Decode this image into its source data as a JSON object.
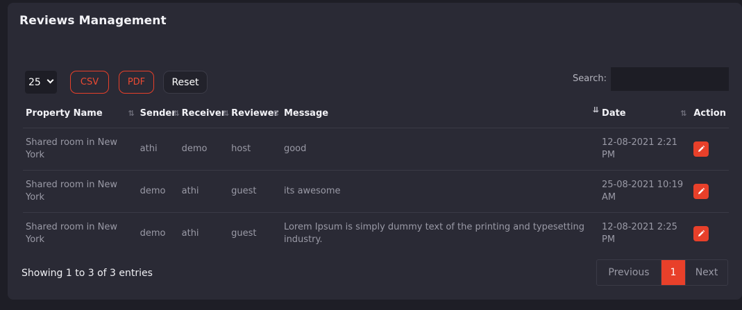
{
  "page": {
    "title": "Reviews Management"
  },
  "toolbar": {
    "page_length": "25",
    "csv_label": "CSV",
    "pdf_label": "PDF",
    "reset_label": "Reset",
    "search_label": "Search:",
    "search_value": ""
  },
  "table": {
    "headers": [
      "Property Name",
      "Sender",
      "Receiver",
      "Reviewer",
      "Message",
      "Date",
      "Action"
    ],
    "rows": [
      {
        "property": "Shared room in New York",
        "sender": "athi",
        "receiver": "demo",
        "reviewer": "host",
        "message": "good",
        "date": "12-08-2021 2:21 PM"
      },
      {
        "property": "Shared room in New York",
        "sender": "demo",
        "receiver": "athi",
        "reviewer": "guest",
        "message": "its awesome",
        "date": "25-08-2021 10:19 AM"
      },
      {
        "property": "Shared room in New York",
        "sender": "demo",
        "receiver": "athi",
        "reviewer": "guest",
        "message": "Lorem Ipsum is simply dummy text of the printing and typesetting industry.",
        "date": "12-08-2021 2:25 PM"
      }
    ]
  },
  "footer": {
    "info": "Showing 1 to 3 of 3 entries",
    "prev_label": "Previous",
    "page_1": "1",
    "next_label": "Next"
  },
  "icons": {
    "edit": "pencil-icon",
    "sort": "sort-arrows-icon",
    "dropdown": "chevron-down-icon"
  },
  "colors": {
    "accent": "#e8402a",
    "card": "#2a2a35",
    "background": "#1e1e26"
  }
}
